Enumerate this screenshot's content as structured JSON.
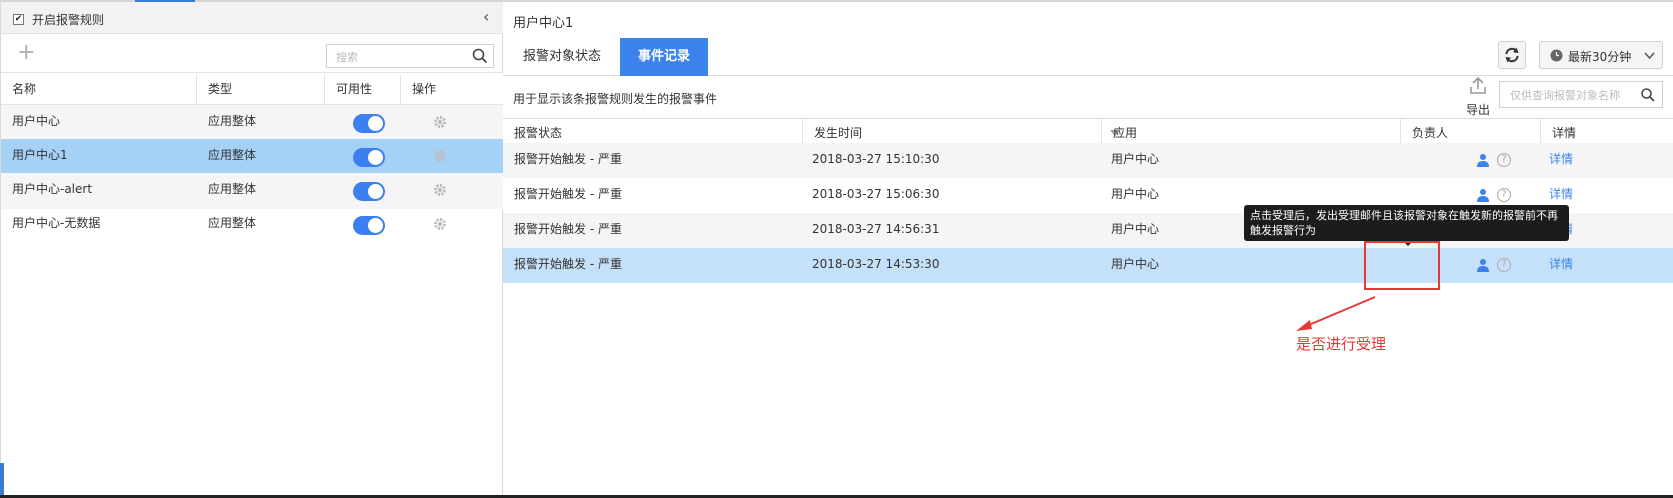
{
  "left": {
    "enable_label": "开启报警规则",
    "enable_checked": true,
    "search_placeholder": "搜索",
    "columns": [
      "名称",
      "类型",
      "可用性",
      "操作"
    ],
    "rows": [
      {
        "name": "用户中心",
        "type": "应用整体",
        "enabled": true
      },
      {
        "name": "用户中心1",
        "type": "应用整体",
        "enabled": true
      },
      {
        "name": "用户中心-alert",
        "type": "应用整体",
        "enabled": true
      },
      {
        "name": "用户中心-无数据",
        "type": "应用整体",
        "enabled": true
      }
    ],
    "selected_row": 1
  },
  "right": {
    "title": "用户中心1",
    "tabs": [
      {
        "label": "报警对象状态",
        "active": false
      },
      {
        "label": "事件记录",
        "active": true
      }
    ],
    "time_range_label": "最新30分钟",
    "description": "用于显示该条报警规则发生的报警事件",
    "export_label": "导出",
    "search_placeholder": "仅供查询报警对象名称",
    "columns": [
      "报警状态",
      "发生时间",
      "应用",
      "负责人",
      "详情"
    ],
    "rows": [
      {
        "status": "报警开始触发 - 严重",
        "time": "2018-03-27 15:10:30",
        "app": "用户中心",
        "detail": "详情"
      },
      {
        "status": "报警开始触发 - 严重",
        "time": "2018-03-27 15:06:30",
        "app": "用户中心",
        "detail": "详情"
      },
      {
        "status": "报警开始触发 - 严重",
        "time": "2018-03-27 14:56:31",
        "app": "用户中心",
        "detail": "详情"
      },
      {
        "status": "报警开始触发 - 严重",
        "time": "2018-03-27 14:53:30",
        "app": "用户中心",
        "detail": "详情"
      }
    ],
    "selected_row": 3,
    "tooltip": "点击受理后，发出受理邮件且该报警对象在触发新的报警前不再触发报警行为"
  },
  "annotation": {
    "text": "是否进行受理",
    "color": "#e53935"
  },
  "colors": {
    "accent": "#3b82ec",
    "selected_left": "#a6d1f7",
    "selected_right": "#c5e1fa"
  }
}
